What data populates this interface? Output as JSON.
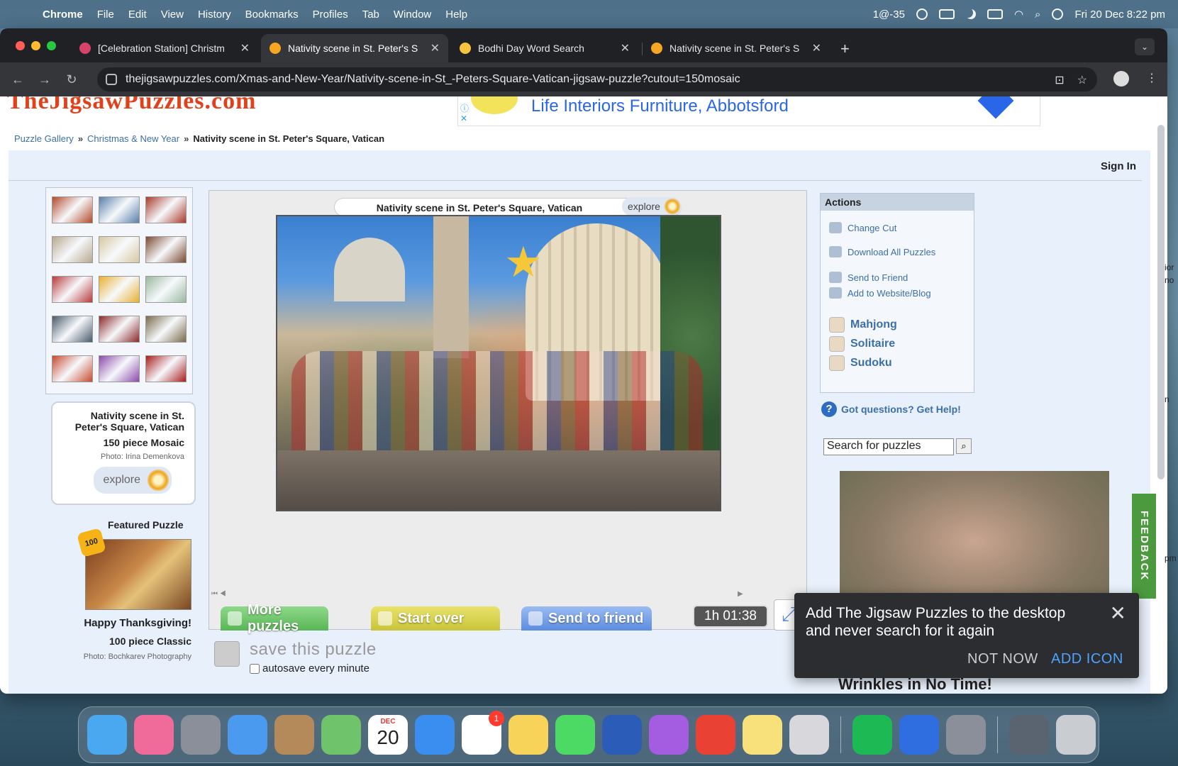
{
  "menubar": {
    "app": "Chrome",
    "items": [
      "File",
      "Edit",
      "View",
      "History",
      "Bookmarks",
      "Profiles",
      "Tab",
      "Window",
      "Help"
    ],
    "status_text": "1@-35",
    "clock": "Fri 20 Dec  8:22 pm"
  },
  "tabs": [
    {
      "title": "[Celebration Station] Christm",
      "active": false,
      "favicon_color": "#d8436b"
    },
    {
      "title": "Nativity scene in St. Peter's S",
      "active": true,
      "favicon_color": "#f5a623"
    },
    {
      "title": "Bodhi Day Word Search",
      "active": false,
      "favicon_color": "#f5c542"
    },
    {
      "title": "Nativity scene in St. Peter's S",
      "active": false,
      "favicon_color": "#f5a623"
    }
  ],
  "browser": {
    "url": "thejigsawpuzzles.com/Xmas-and-New-Year/Nativity-scene-in-St_-Peters-Square-Vatican-jigsaw-puzzle?cutout=150mosaic"
  },
  "site": {
    "logo_text": "TheJigsawPuzzles.com",
    "ad_text": "Life Interiors Furniture, Abbotsford",
    "breadcrumb": {
      "gallery": "Puzzle Gallery",
      "category": "Christmas & New Year",
      "current": "Nativity scene in St. Peter's Square, Vatican",
      "separator": "»"
    },
    "sign_in": "Sign In"
  },
  "puzzle_info": {
    "title": "Nativity scene in St. Peter's Square, Vatican",
    "pieces": "150 piece Mosaic",
    "photo_credit": "Photo: Irina Demenkova",
    "explore_label": "explore"
  },
  "featured": {
    "label": "Featured Puzzle",
    "badge": "100",
    "title": "Happy Thanksgiving!",
    "pieces": "100 piece Classic",
    "photo_credit": "Photo: Bochkarev Photography"
  },
  "board": {
    "title": "Nativity scene in St. Peter's Square, Vatican",
    "explore_label": "explore",
    "more_puzzles": "More puzzles",
    "start_over": "Start over",
    "send_to_friend": "Send to friend",
    "timer": "1h 01:38",
    "save_label": "save this puzzle",
    "autosave_label": "autosave every minute",
    "autosave_checked": false
  },
  "actions": {
    "header": "Actions",
    "change_cut": "Change Cut",
    "download_all": "Download All Puzzles",
    "send_to_friend": "Send to Friend",
    "add_to_website": "Add to Website/Blog",
    "games": [
      "Mahjong",
      "Solitaire",
      "Sudoku"
    ],
    "help": "Got questions? Get Help!",
    "search_placeholder": "Search for puzzles"
  },
  "ad_headline": "Wrinkles in No Time!",
  "feedback": "FEEDBACK",
  "cut_text": [
    "ior",
    "no",
    "n",
    "pm"
  ],
  "toast": {
    "message": "Add The Jigsaw Puzzles to the desktop and never search for it again",
    "not_now": "NOT NOW",
    "add_icon": "ADD ICON"
  },
  "dock": {
    "calendar_month": "DEC",
    "calendar_day": "20",
    "reminders_badge": "1",
    "apps": [
      {
        "name": "finder",
        "color": "#4aa8f0"
      },
      {
        "name": "affinity",
        "color": "#f06a9a"
      },
      {
        "name": "launchpad",
        "color": "#8a8f99"
      },
      {
        "name": "mail",
        "color": "#4a9bf0"
      },
      {
        "name": "contacts",
        "color": "#b58a5a"
      },
      {
        "name": "maps",
        "color": "#6fc36a"
      },
      {
        "name": "calendar",
        "color": "#ffffff"
      },
      {
        "name": "safari",
        "color": "#3a8ef0"
      },
      {
        "name": "reminders",
        "color": "#ffffff"
      },
      {
        "name": "photos",
        "color": "#f7d35a"
      },
      {
        "name": "facetime",
        "color": "#4cd964"
      },
      {
        "name": "word",
        "color": "#2b5cb8"
      },
      {
        "name": "podcasts",
        "color": "#a45ce0"
      },
      {
        "name": "chrome",
        "color": "#e94235"
      },
      {
        "name": "notes",
        "color": "#f8e07a"
      },
      {
        "name": "iphone-mirroring",
        "color": "#d7d7dc"
      },
      {
        "name": "spotify",
        "color": "#1db954"
      },
      {
        "name": "mailbird",
        "color": "#2f6ee0"
      },
      {
        "name": "system-settings",
        "color": "#8a8f99"
      },
      {
        "name": "downloads-stack",
        "color": "#5a6470"
      },
      {
        "name": "trash",
        "color": "#c9ccd1"
      }
    ]
  },
  "thumbnails": [
    "#b24a2a",
    "#5a7fa8",
    "#a83a2a",
    "#b8a890",
    "#d8c8a0",
    "#7a4a30",
    "#b83a3a",
    "#e8b030",
    "#9ab8a0",
    "#4a5a6a",
    "#8a2a2a",
    "#7a6a4a",
    "#c84a30",
    "#8a4aa8",
    "#a81e1e"
  ]
}
